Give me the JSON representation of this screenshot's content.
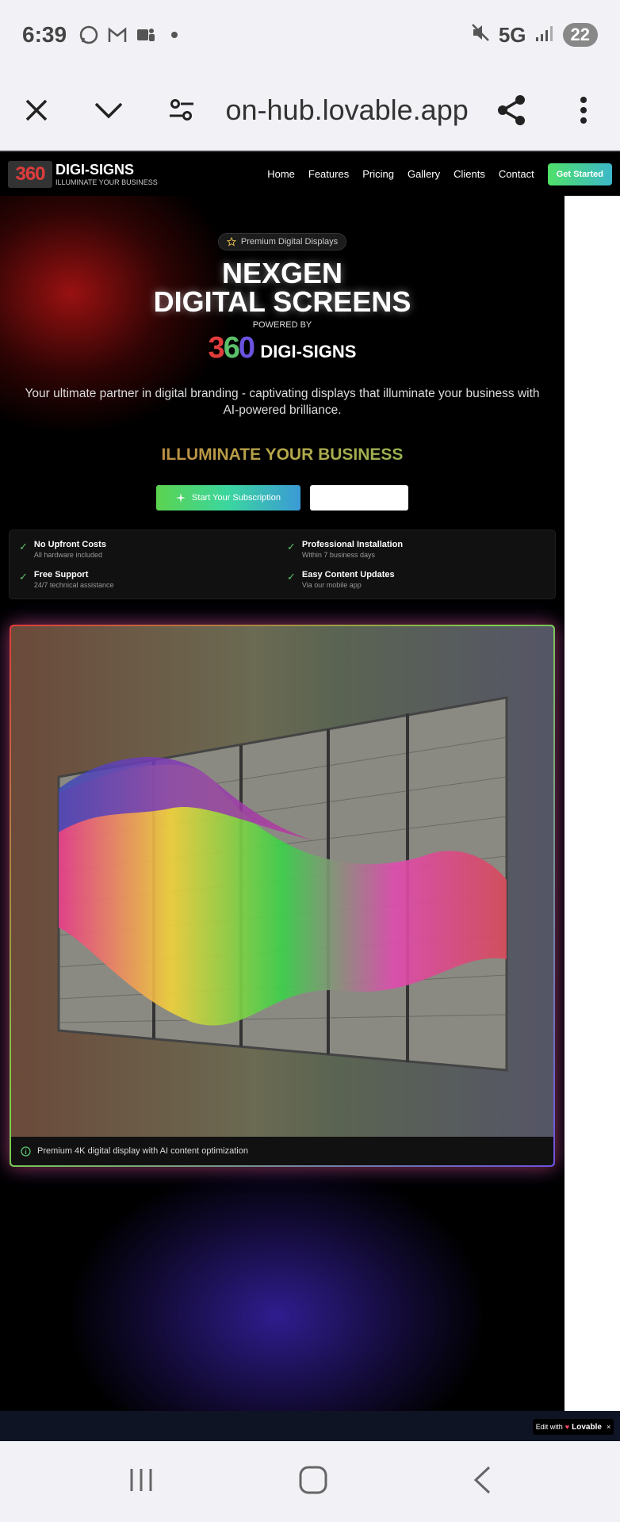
{
  "status": {
    "time": "6:39",
    "network": "5G",
    "battery": "22"
  },
  "browser": {
    "url": "on-hub.lovable.app"
  },
  "nav": {
    "logo_mark": "360",
    "logo_title": "DIGI-SIGNS",
    "logo_sub": "ILLUMINATE YOUR BUSINESS",
    "links": [
      "Home",
      "Features",
      "Pricing",
      "Gallery",
      "Clients",
      "Contact"
    ],
    "cta": "Get Started"
  },
  "hero": {
    "pill": "Premium Digital Displays",
    "title_line1": "NEXGEN",
    "title_line2": "DIGITAL SCREENS",
    "powered": "POWERED BY",
    "brand_digits": [
      "3",
      "6",
      "0"
    ],
    "brand_word": "DIGI-SIGNS",
    "tagline": "Your ultimate partner in digital branding - captivating displays that illuminate your business with AI-powered brilliance.",
    "illuminate": "ILLUMINATE YOUR BUSINESS",
    "subscribe_btn": "Start Your Subscription",
    "secondary_btn": ""
  },
  "features": [
    {
      "title": "No Upfront Costs",
      "sub": "All hardware included"
    },
    {
      "title": "Professional Installation",
      "sub": "Within 7 business days"
    },
    {
      "title": "Free Support",
      "sub": "24/7 technical assistance"
    },
    {
      "title": "Easy Content Updates",
      "sub": "Via our mobile app"
    }
  ],
  "display": {
    "caption": "Premium 4K digital display with AI content optimization"
  },
  "lovable": {
    "prefix": "Edit with",
    "brand": "Lovable"
  },
  "colors": {
    "red": "#e03c3c",
    "green": "#5ac06a",
    "blue": "#6b52e0",
    "cta_green": "#4fe06a"
  }
}
